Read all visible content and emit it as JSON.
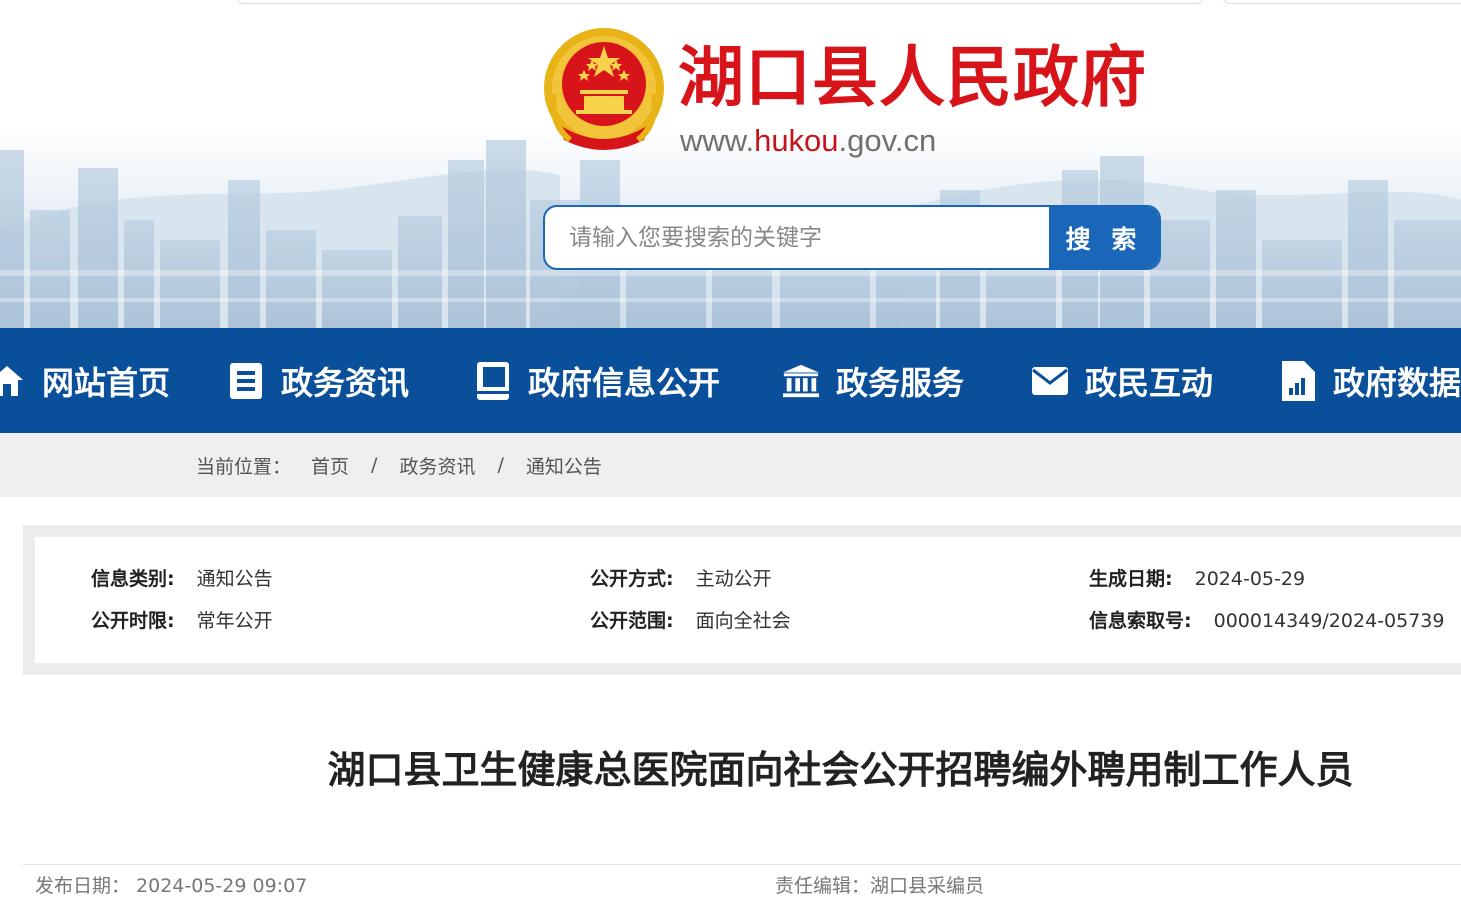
{
  "header": {
    "site_title": "湖口县人民政府",
    "site_url_prefix": "www.",
    "site_url_highlight": "hukou",
    "site_url_suffix": ".gov.cn",
    "emblem_icon": "national-emblem-icon",
    "search": {
      "placeholder": "请输入您要搜索的关键字",
      "value": "",
      "button_label": "搜 索"
    }
  },
  "nav": {
    "items": [
      {
        "label": "网站首页",
        "icon": "home-icon"
      },
      {
        "label": "政务资讯",
        "icon": "document-list-icon"
      },
      {
        "label": "政府信息公开",
        "icon": "book-icon"
      },
      {
        "label": "政务服务",
        "icon": "government-building-icon"
      },
      {
        "label": "政民互动",
        "icon": "envelope-icon"
      },
      {
        "label": "政府数据",
        "icon": "data-file-icon"
      }
    ]
  },
  "breadcrumb": {
    "prefix": "当前位置：",
    "items": [
      "首页",
      "政务资讯",
      "通知公告"
    ],
    "separator": "/"
  },
  "meta": {
    "category_label": "信息类别:",
    "category_value": "通知公告",
    "open_mode_label": "公开方式:",
    "open_mode_value": "主动公开",
    "created_label": "生成日期:",
    "created_value": "2024-05-29",
    "period_label": "公开时限:",
    "period_value": "常年公开",
    "scope_label": "公开范围:",
    "scope_value": "面向全社会",
    "index_label": "信息索取号:",
    "index_value": "000014349/2024-05739"
  },
  "article": {
    "title": "湖口县卫生健康总医院面向社会公开招聘编外聘用制工作人员",
    "publish_info": "发布日期：  2024-05-29 09:07",
    "editor_info": "责任编辑：湖口县采编员"
  },
  "colors": {
    "brand_red": "#d7141a",
    "nav_blue": "#0a4f9a",
    "search_blue": "#1a66b8",
    "breadcrumb_bg": "#efefef"
  }
}
